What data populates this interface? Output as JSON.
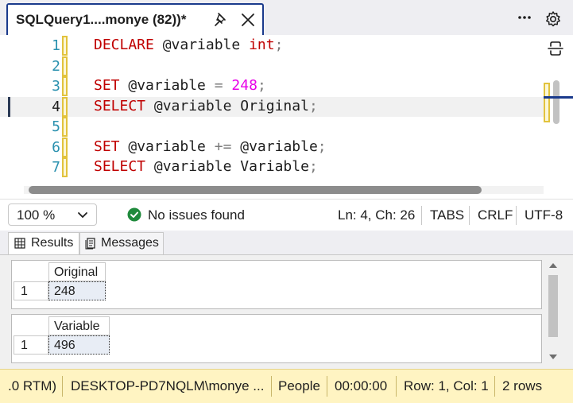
{
  "tab": {
    "title": "SQLQuery1....monye (82))*"
  },
  "editor": {
    "lines": [
      {
        "num": "1",
        "tokens": [
          {
            "t": "DECLARE",
            "c": "kw"
          },
          {
            "t": " @variable ",
            "c": "plain"
          },
          {
            "t": "int",
            "c": "kw"
          },
          {
            "t": ";",
            "c": "punc"
          }
        ]
      },
      {
        "num": "2",
        "tokens": []
      },
      {
        "num": "3",
        "tokens": [
          {
            "t": "SET",
            "c": "kw"
          },
          {
            "t": " @variable ",
            "c": "plain"
          },
          {
            "t": "=",
            "c": "punc"
          },
          {
            "t": " ",
            "c": "plain"
          },
          {
            "t": "248",
            "c": "num"
          },
          {
            "t": ";",
            "c": "punc"
          }
        ]
      },
      {
        "num": "4",
        "tokens": [
          {
            "t": "SELECT",
            "c": "kw"
          },
          {
            "t": " @variable Original",
            "c": "plain"
          },
          {
            "t": ";",
            "c": "punc"
          }
        ]
      },
      {
        "num": "5",
        "tokens": []
      },
      {
        "num": "6",
        "tokens": [
          {
            "t": "SET",
            "c": "kw"
          },
          {
            "t": " @variable ",
            "c": "plain"
          },
          {
            "t": "+=",
            "c": "punc"
          },
          {
            "t": " @variable",
            "c": "plain"
          },
          {
            "t": ";",
            "c": "punc"
          }
        ]
      },
      {
        "num": "7",
        "tokens": [
          {
            "t": "SELECT",
            "c": "kw"
          },
          {
            "t": " @variable Variable",
            "c": "plain"
          },
          {
            "t": ";",
            "c": "punc"
          }
        ]
      }
    ]
  },
  "infobar": {
    "zoom": "100 %",
    "issues": "No issues found",
    "position": "Ln: 4, Ch: 26",
    "tabs": "TABS",
    "line_ending": "CRLF",
    "encoding": "UTF-8"
  },
  "results_tabs": {
    "results": "Results",
    "messages": "Messages"
  },
  "grids": [
    {
      "column": "Original",
      "row_num": "1",
      "value": "248"
    },
    {
      "column": "Variable",
      "row_num": "1",
      "value": "496"
    }
  ],
  "statusbar": {
    "version": ".0 RTM)",
    "server": "DESKTOP-PD7NQLM\\monye ...",
    "user": "People",
    "elapsed": "00:00:00",
    "rowcol": "Row: 1, Col: 1",
    "rows": "2 rows"
  },
  "colors": {
    "accent": "#1a3a8c",
    "status_bg": "#fff4c2",
    "keyword": "#c00000",
    "number": "#e800e8",
    "line_number": "#2b91af"
  }
}
